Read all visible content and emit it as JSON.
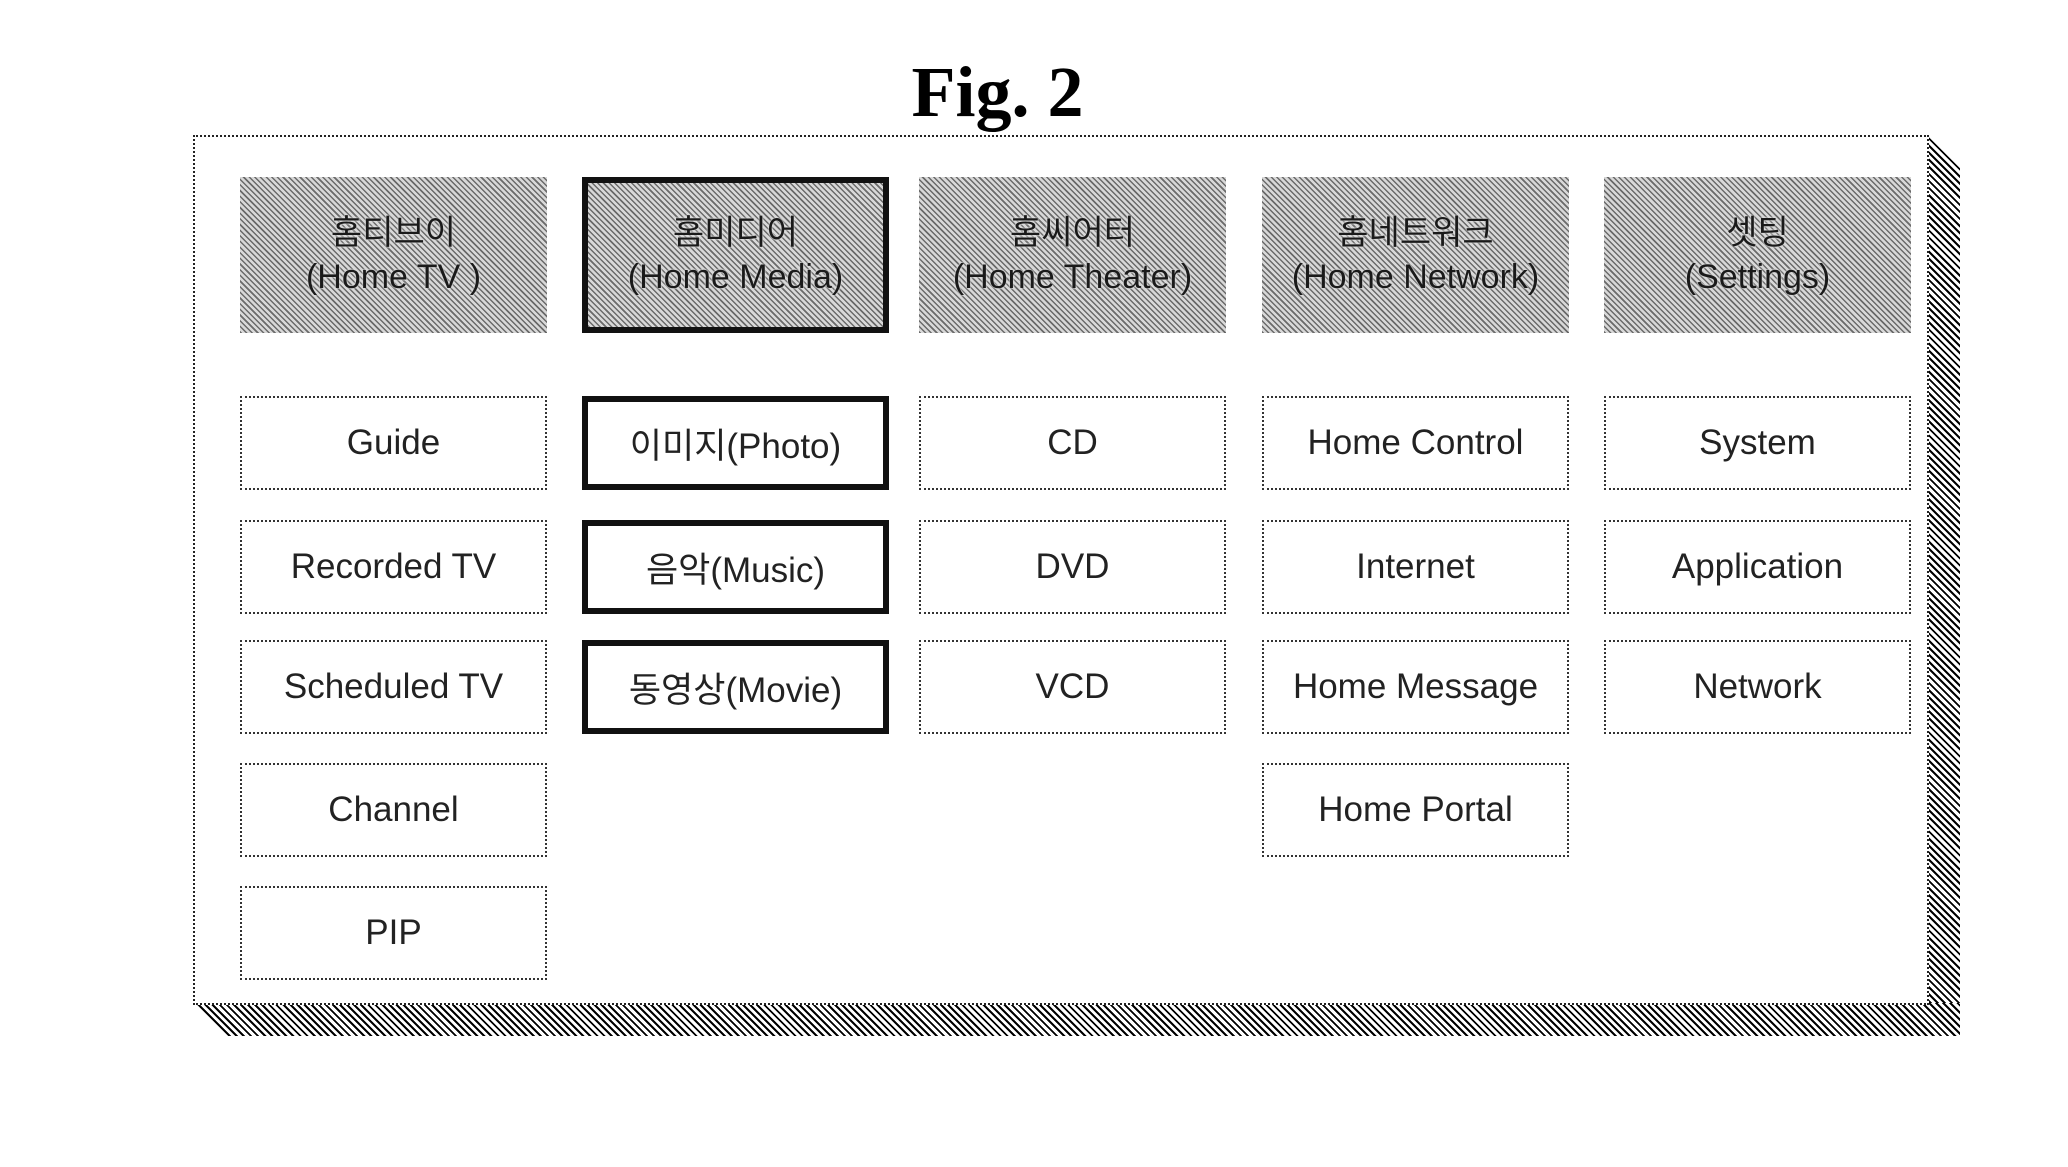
{
  "figure": {
    "title": "Fig. 2"
  },
  "menu": {
    "columns": [
      {
        "header_ko": "홈티브이",
        "header_en": "(Home TV )",
        "selected": false,
        "items": [
          {
            "label": "Guide",
            "selected": false
          },
          {
            "label": "Recorded TV",
            "selected": false
          },
          {
            "label": "Scheduled TV",
            "selected": false
          },
          {
            "label": "Channel",
            "selected": false
          },
          {
            "label": "PIP",
            "selected": false
          }
        ]
      },
      {
        "header_ko": "홈미디어",
        "header_en": "(Home Media)",
        "selected": true,
        "items": [
          {
            "label": "이미지(Photo)",
            "selected": true
          },
          {
            "label": "음악(Music)",
            "selected": true
          },
          {
            "label": "동영상(Movie)",
            "selected": true
          }
        ]
      },
      {
        "header_ko": "홈씨어터",
        "header_en": "(Home Theater)",
        "selected": false,
        "items": [
          {
            "label": "CD",
            "selected": false
          },
          {
            "label": "DVD",
            "selected": false
          },
          {
            "label": "VCD",
            "selected": false
          }
        ]
      },
      {
        "header_ko": "홈네트워크",
        "header_en": "(Home Network)",
        "selected": false,
        "items": [
          {
            "label": "Home Control",
            "selected": false
          },
          {
            "label": "Internet",
            "selected": false
          },
          {
            "label": "Home Message",
            "selected": false
          },
          {
            "label": "Home Portal",
            "selected": false
          }
        ]
      },
      {
        "header_ko": "셋팅",
        "header_en": "(Settings)",
        "selected": false,
        "items": [
          {
            "label": "System",
            "selected": false
          },
          {
            "label": "Application",
            "selected": false
          },
          {
            "label": "Network",
            "selected": false
          }
        ]
      }
    ]
  }
}
